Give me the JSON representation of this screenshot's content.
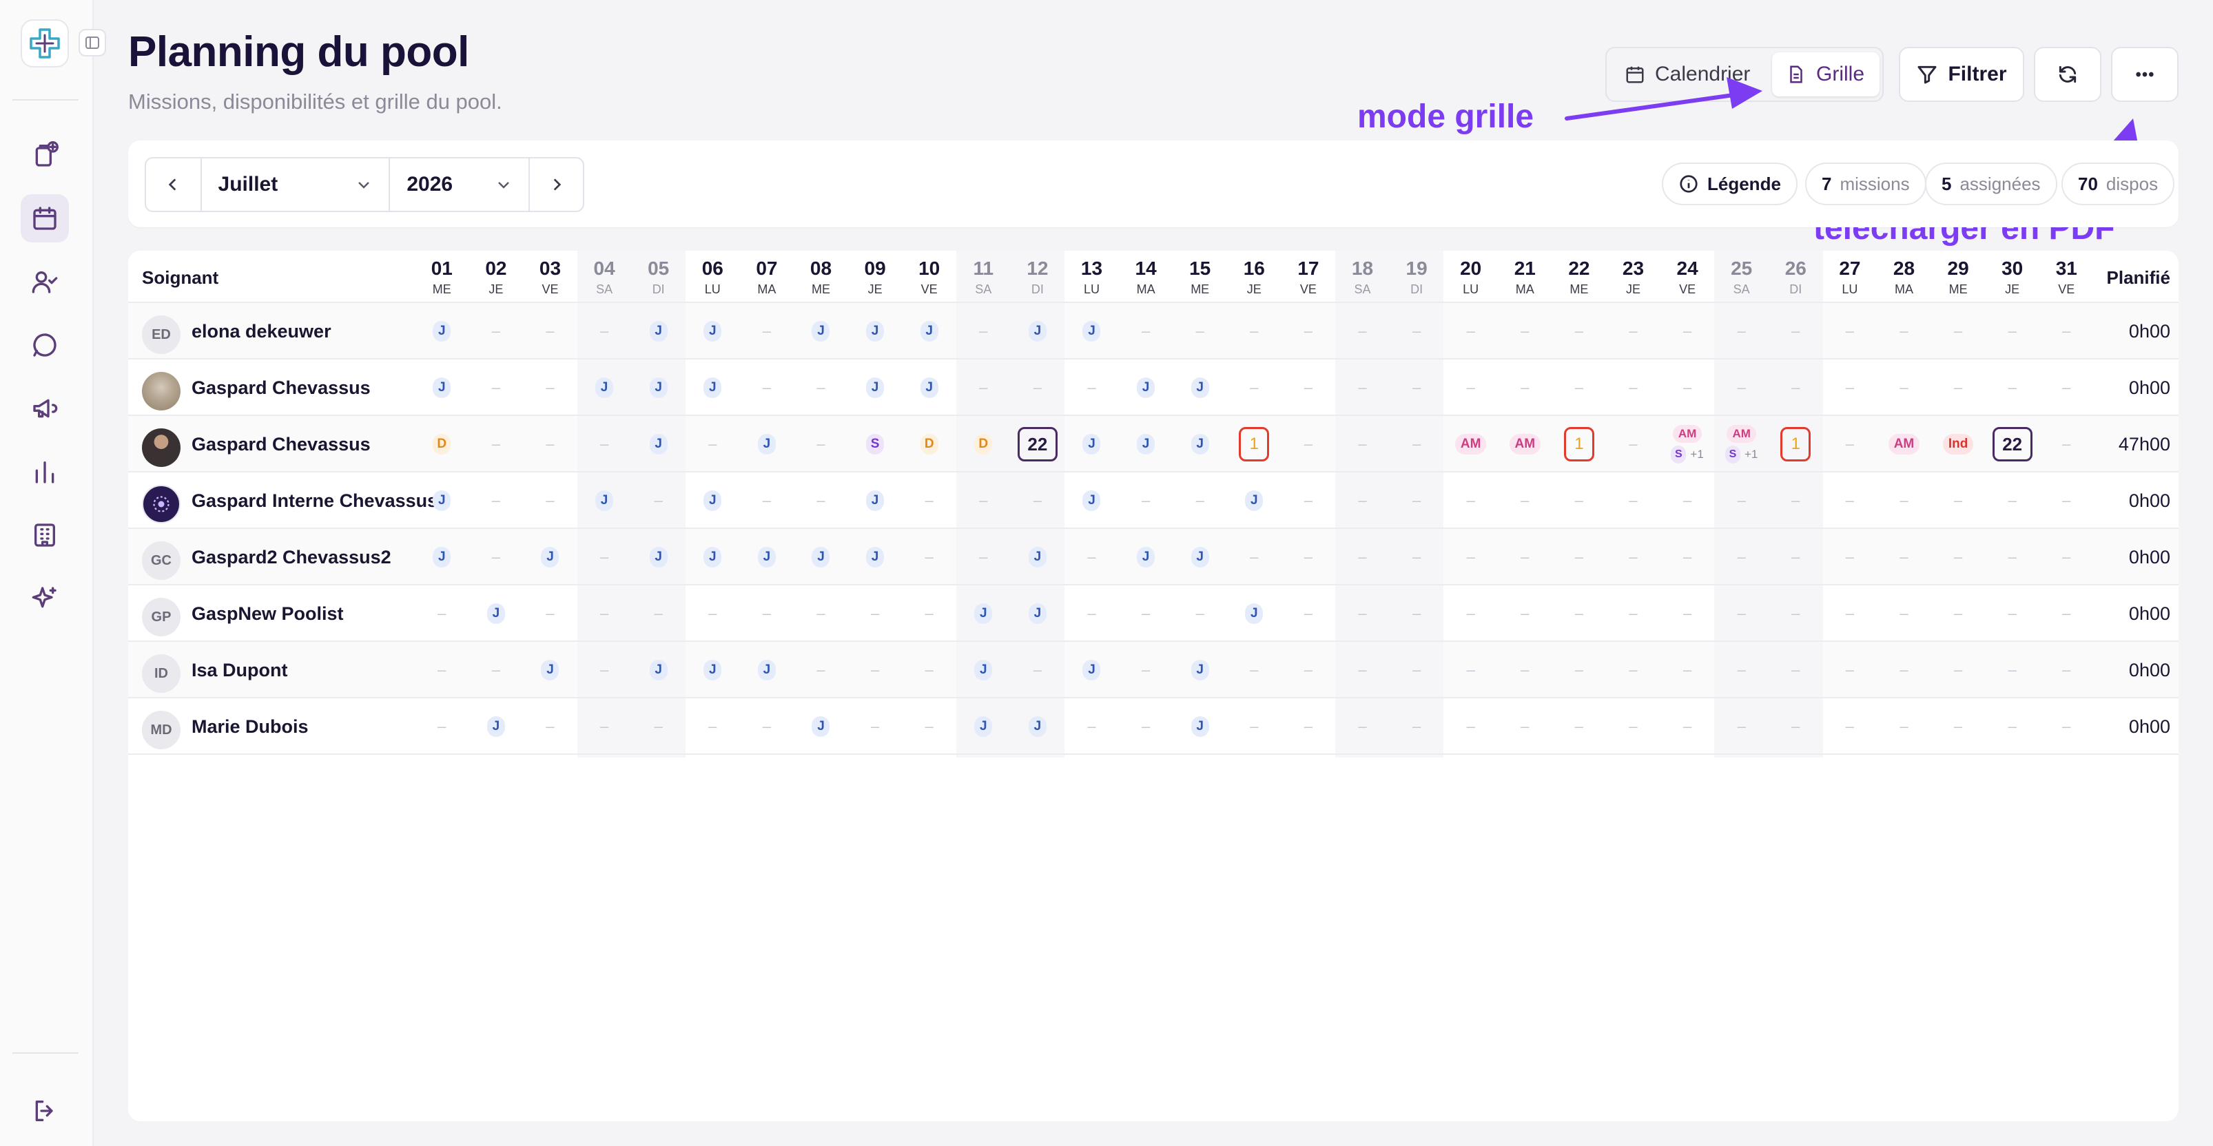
{
  "header": {
    "title": "Planning du pool",
    "subtitle": "Missions, disponibilités et grille du pool.",
    "view_calendar": "Calendrier",
    "view_grid": "Grille",
    "filter_label": "Filtrer"
  },
  "annotations": {
    "grid_mode": "mode grille",
    "pdf_download": "télécharger en PDF"
  },
  "toolbar": {
    "month": "Juillet",
    "year": "2026",
    "legend_label": "Légende",
    "missions_count": "7",
    "missions_label": "missions",
    "assigned_count": "5",
    "assigned_label": "assignées",
    "dispos_count": "70",
    "dispos_label": "dispos"
  },
  "grid": {
    "name_header": "Soignant",
    "planned_header": "Planifié",
    "days": [
      {
        "n": "01",
        "d": "ME"
      },
      {
        "n": "02",
        "d": "JE"
      },
      {
        "n": "03",
        "d": "VE"
      },
      {
        "n": "04",
        "d": "SA"
      },
      {
        "n": "05",
        "d": "DI"
      },
      {
        "n": "06",
        "d": "LU"
      },
      {
        "n": "07",
        "d": "MA"
      },
      {
        "n": "08",
        "d": "ME"
      },
      {
        "n": "09",
        "d": "JE"
      },
      {
        "n": "10",
        "d": "VE"
      },
      {
        "n": "11",
        "d": "SA"
      },
      {
        "n": "12",
        "d": "DI"
      },
      {
        "n": "13",
        "d": "LU"
      },
      {
        "n": "14",
        "d": "MA"
      },
      {
        "n": "15",
        "d": "ME"
      },
      {
        "n": "16",
        "d": "JE"
      },
      {
        "n": "17",
        "d": "VE"
      },
      {
        "n": "18",
        "d": "SA"
      },
      {
        "n": "19",
        "d": "DI"
      },
      {
        "n": "20",
        "d": "LU"
      },
      {
        "n": "21",
        "d": "MA"
      },
      {
        "n": "22",
        "d": "ME"
      },
      {
        "n": "23",
        "d": "JE"
      },
      {
        "n": "24",
        "d": "VE"
      },
      {
        "n": "25",
        "d": "SA"
      },
      {
        "n": "26",
        "d": "DI"
      },
      {
        "n": "27",
        "d": "LU"
      },
      {
        "n": "28",
        "d": "MA"
      },
      {
        "n": "29",
        "d": "ME"
      },
      {
        "n": "30",
        "d": "JE"
      },
      {
        "n": "31",
        "d": "VE"
      }
    ],
    "rows": [
      {
        "initials": "ED",
        "avatar": "initials",
        "name": "elona dekeuwer",
        "planned": "0h00",
        "cells": [
          "J",
          "-",
          "-",
          "-",
          "J",
          "J",
          "-",
          "J",
          "J",
          "J",
          "-",
          "J",
          "J",
          "-",
          "-",
          "-",
          "-",
          "-",
          "-",
          "-",
          "-",
          "-",
          "-",
          "-",
          "-",
          "-",
          "-",
          "-",
          "-",
          "-",
          "-"
        ]
      },
      {
        "initials": "",
        "avatar": "photo1",
        "name": "Gaspard Chevassus",
        "planned": "0h00",
        "cells": [
          "J",
          "-",
          "-",
          "J",
          "J",
          "J",
          "-",
          "-",
          "J",
          "J",
          "-",
          "-",
          "-",
          "J",
          "J",
          "-",
          "-",
          "-",
          "-",
          "-",
          "-",
          "-",
          "-",
          "-",
          "-",
          "-",
          "-",
          "-",
          "-",
          "-",
          "-"
        ]
      },
      {
        "initials": "",
        "avatar": "photo2",
        "name": "Gaspard Chevassus",
        "planned": "47h00",
        "cells": [
          "D",
          "-",
          "-",
          "-",
          "J",
          "-",
          "J",
          "-",
          "S",
          "D",
          "D",
          "B22",
          "J",
          "J",
          "J",
          "B1",
          "-",
          "-",
          "-",
          "AM",
          "AM",
          "B1",
          "-",
          "AMS",
          "AMS",
          "B1",
          "-",
          "AM",
          "Ind",
          "B22",
          "-"
        ]
      },
      {
        "initials": "",
        "avatar": "logo",
        "name": "Gaspard Interne Chevassus",
        "planned": "0h00",
        "cells": [
          "J",
          "-",
          "-",
          "J",
          "-",
          "J",
          "-",
          "-",
          "J",
          "-",
          "-",
          "-",
          "J",
          "-",
          "-",
          "J",
          "-",
          "-",
          "-",
          "-",
          "-",
          "-",
          "-",
          "-",
          "-",
          "-",
          "-",
          "-",
          "-",
          "-",
          "-"
        ]
      },
      {
        "initials": "GC",
        "avatar": "initials",
        "name": "Gaspard2 Chevassus2",
        "planned": "0h00",
        "cells": [
          "J",
          "-",
          "J",
          "-",
          "J",
          "J",
          "J",
          "J",
          "J",
          "-",
          "-",
          "J",
          "-",
          "J",
          "J",
          "-",
          "-",
          "-",
          "-",
          "-",
          "-",
          "-",
          "-",
          "-",
          "-",
          "-",
          "-",
          "-",
          "-",
          "-",
          "-"
        ]
      },
      {
        "initials": "GP",
        "avatar": "initials",
        "name": "GaspNew Poolist",
        "planned": "0h00",
        "cells": [
          "-",
          "J",
          "-",
          "-",
          "-",
          "-",
          "-",
          "-",
          "-",
          "-",
          "J",
          "J",
          "-",
          "-",
          "-",
          "J",
          "-",
          "-",
          "-",
          "-",
          "-",
          "-",
          "-",
          "-",
          "-",
          "-",
          "-",
          "-",
          "-",
          "-",
          "-"
        ]
      },
      {
        "initials": "ID",
        "avatar": "initials",
        "name": "Isa Dupont",
        "planned": "0h00",
        "cells": [
          "-",
          "-",
          "J",
          "-",
          "J",
          "J",
          "J",
          "-",
          "-",
          "-",
          "J",
          "-",
          "J",
          "-",
          "J",
          "-",
          "-",
          "-",
          "-",
          "-",
          "-",
          "-",
          "-",
          "-",
          "-",
          "-",
          "-",
          "-",
          "-",
          "-",
          "-"
        ]
      },
      {
        "initials": "MD",
        "avatar": "initials",
        "name": "Marie Dubois",
        "planned": "0h00",
        "cells": [
          "-",
          "J",
          "-",
          "-",
          "-",
          "-",
          "-",
          "J",
          "-",
          "-",
          "J",
          "J",
          "-",
          "-",
          "J",
          "-",
          "-",
          "-",
          "-",
          "-",
          "-",
          "-",
          "-",
          "-",
          "-",
          "-",
          "-",
          "-",
          "-",
          "-",
          "-"
        ]
      }
    ],
    "cell_texts": {
      "B22": "22",
      "B1": "1",
      "AM": "AM",
      "S": "S",
      "plus": "+1",
      "Ind": "Ind",
      "dash": "–"
    }
  },
  "colors": {
    "accent": "#5b2b82",
    "annotation": "#7b3cf2"
  }
}
